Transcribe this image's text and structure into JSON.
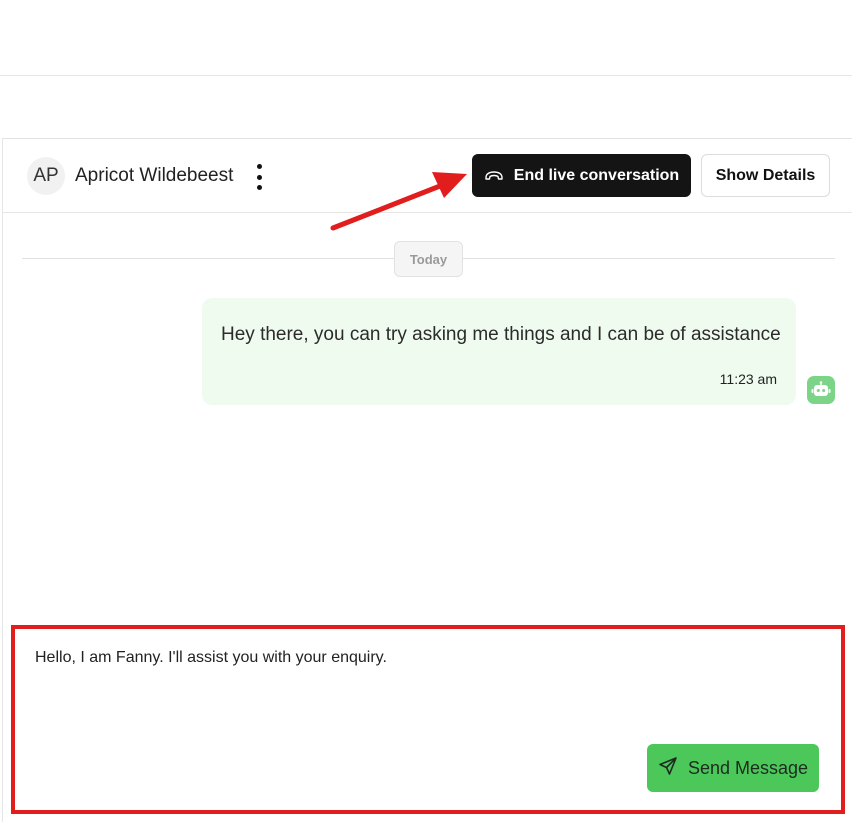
{
  "header": {
    "avatar_initials": "AP",
    "contact_name": "Apricot Wildebeest",
    "end_button_label": "End live conversation",
    "details_button_label": "Show Details"
  },
  "conversation": {
    "date_label": "Today",
    "messages": [
      {
        "sender": "bot",
        "text": "Hey there, you can try asking me things and I can be of assistance",
        "time": "11:23 am"
      }
    ]
  },
  "composer": {
    "value": "Hello, I am Fanny. I'll assist you with your enquiry.",
    "send_label": "Send Message"
  },
  "icons": {
    "menu": "kebab-menu-icon",
    "end_call": "hang-up-phone-icon",
    "bot": "robot-icon",
    "send": "paper-plane-icon"
  },
  "colors": {
    "end_button_bg": "#141414",
    "message_bubble_bg": "#f0fbf0",
    "bot_avatar_bg": "#7bd487",
    "send_button_bg": "#4cc85b",
    "annotation_red": "#e11d1d"
  }
}
